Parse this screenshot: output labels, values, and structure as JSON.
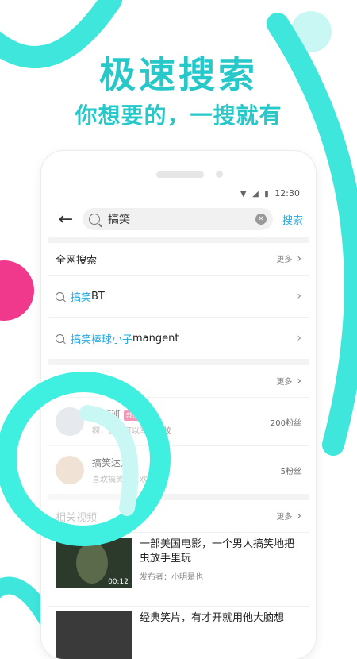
{
  "headline": "极速搜索",
  "subheadline": "你想要的，一搜就有",
  "colors": {
    "accent": "#27c8c9",
    "link": "#27a9e1",
    "pink": "#f06292",
    "ring": "#3ff0e0"
  },
  "status": {
    "time": "12:30"
  },
  "search": {
    "query": "搞笑",
    "button": "搜索"
  },
  "web_section": {
    "title": "全网搜索",
    "more": "更多",
    "items": [
      {
        "highlight": "搞笑",
        "rest": " BT"
      },
      {
        "highlight": "搞笑棒球小子",
        "rest": " mangent"
      }
    ]
  },
  "user_section": {
    "more": "更多",
    "users": [
      {
        "name": "搞笑班",
        "badge": "部落主播",
        "desc": "啊，自己可以写的学校",
        "fans": "200粉丝"
      },
      {
        "name": "搞笑达人",
        "desc": "喜欢搞笑，喜欢分享",
        "fans": "5粉丝"
      }
    ]
  },
  "video_section": {
    "title": "相关视频",
    "more": "更多",
    "videos": [
      {
        "title": "一部美国电影，一个男人搞笑地把虫放手里玩",
        "publisher": "发布者：小明是也",
        "duration": "00:12"
      },
      {
        "title": "经典笑片，有才开就用他大脑想",
        "publisher": "",
        "duration": ""
      }
    ]
  }
}
